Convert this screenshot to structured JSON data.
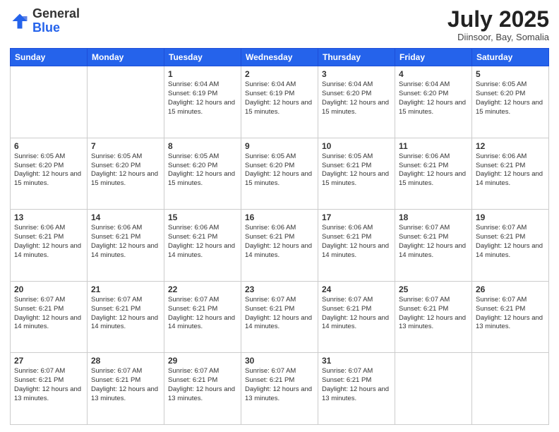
{
  "header": {
    "logo_general": "General",
    "logo_blue": "Blue",
    "month_title": "July 2025",
    "location": "Diinsoor, Bay, Somalia"
  },
  "days_of_week": [
    "Sunday",
    "Monday",
    "Tuesday",
    "Wednesday",
    "Thursday",
    "Friday",
    "Saturday"
  ],
  "weeks": [
    [
      {
        "day": "",
        "text": ""
      },
      {
        "day": "",
        "text": ""
      },
      {
        "day": "1",
        "text": "Sunrise: 6:04 AM\nSunset: 6:19 PM\nDaylight: 12 hours and 15 minutes."
      },
      {
        "day": "2",
        "text": "Sunrise: 6:04 AM\nSunset: 6:19 PM\nDaylight: 12 hours and 15 minutes."
      },
      {
        "day": "3",
        "text": "Sunrise: 6:04 AM\nSunset: 6:20 PM\nDaylight: 12 hours and 15 minutes."
      },
      {
        "day": "4",
        "text": "Sunrise: 6:04 AM\nSunset: 6:20 PM\nDaylight: 12 hours and 15 minutes."
      },
      {
        "day": "5",
        "text": "Sunrise: 6:05 AM\nSunset: 6:20 PM\nDaylight: 12 hours and 15 minutes."
      }
    ],
    [
      {
        "day": "6",
        "text": "Sunrise: 6:05 AM\nSunset: 6:20 PM\nDaylight: 12 hours and 15 minutes."
      },
      {
        "day": "7",
        "text": "Sunrise: 6:05 AM\nSunset: 6:20 PM\nDaylight: 12 hours and 15 minutes."
      },
      {
        "day": "8",
        "text": "Sunrise: 6:05 AM\nSunset: 6:20 PM\nDaylight: 12 hours and 15 minutes."
      },
      {
        "day": "9",
        "text": "Sunrise: 6:05 AM\nSunset: 6:20 PM\nDaylight: 12 hours and 15 minutes."
      },
      {
        "day": "10",
        "text": "Sunrise: 6:05 AM\nSunset: 6:21 PM\nDaylight: 12 hours and 15 minutes."
      },
      {
        "day": "11",
        "text": "Sunrise: 6:06 AM\nSunset: 6:21 PM\nDaylight: 12 hours and 15 minutes."
      },
      {
        "day": "12",
        "text": "Sunrise: 6:06 AM\nSunset: 6:21 PM\nDaylight: 12 hours and 14 minutes."
      }
    ],
    [
      {
        "day": "13",
        "text": "Sunrise: 6:06 AM\nSunset: 6:21 PM\nDaylight: 12 hours and 14 minutes."
      },
      {
        "day": "14",
        "text": "Sunrise: 6:06 AM\nSunset: 6:21 PM\nDaylight: 12 hours and 14 minutes."
      },
      {
        "day": "15",
        "text": "Sunrise: 6:06 AM\nSunset: 6:21 PM\nDaylight: 12 hours and 14 minutes."
      },
      {
        "day": "16",
        "text": "Sunrise: 6:06 AM\nSunset: 6:21 PM\nDaylight: 12 hours and 14 minutes."
      },
      {
        "day": "17",
        "text": "Sunrise: 6:06 AM\nSunset: 6:21 PM\nDaylight: 12 hours and 14 minutes."
      },
      {
        "day": "18",
        "text": "Sunrise: 6:07 AM\nSunset: 6:21 PM\nDaylight: 12 hours and 14 minutes."
      },
      {
        "day": "19",
        "text": "Sunrise: 6:07 AM\nSunset: 6:21 PM\nDaylight: 12 hours and 14 minutes."
      }
    ],
    [
      {
        "day": "20",
        "text": "Sunrise: 6:07 AM\nSunset: 6:21 PM\nDaylight: 12 hours and 14 minutes."
      },
      {
        "day": "21",
        "text": "Sunrise: 6:07 AM\nSunset: 6:21 PM\nDaylight: 12 hours and 14 minutes."
      },
      {
        "day": "22",
        "text": "Sunrise: 6:07 AM\nSunset: 6:21 PM\nDaylight: 12 hours and 14 minutes."
      },
      {
        "day": "23",
        "text": "Sunrise: 6:07 AM\nSunset: 6:21 PM\nDaylight: 12 hours and 14 minutes."
      },
      {
        "day": "24",
        "text": "Sunrise: 6:07 AM\nSunset: 6:21 PM\nDaylight: 12 hours and 14 minutes."
      },
      {
        "day": "25",
        "text": "Sunrise: 6:07 AM\nSunset: 6:21 PM\nDaylight: 12 hours and 13 minutes."
      },
      {
        "day": "26",
        "text": "Sunrise: 6:07 AM\nSunset: 6:21 PM\nDaylight: 12 hours and 13 minutes."
      }
    ],
    [
      {
        "day": "27",
        "text": "Sunrise: 6:07 AM\nSunset: 6:21 PM\nDaylight: 12 hours and 13 minutes."
      },
      {
        "day": "28",
        "text": "Sunrise: 6:07 AM\nSunset: 6:21 PM\nDaylight: 12 hours and 13 minutes."
      },
      {
        "day": "29",
        "text": "Sunrise: 6:07 AM\nSunset: 6:21 PM\nDaylight: 12 hours and 13 minutes."
      },
      {
        "day": "30",
        "text": "Sunrise: 6:07 AM\nSunset: 6:21 PM\nDaylight: 12 hours and 13 minutes."
      },
      {
        "day": "31",
        "text": "Sunrise: 6:07 AM\nSunset: 6:21 PM\nDaylight: 12 hours and 13 minutes."
      },
      {
        "day": "",
        "text": ""
      },
      {
        "day": "",
        "text": ""
      }
    ]
  ]
}
